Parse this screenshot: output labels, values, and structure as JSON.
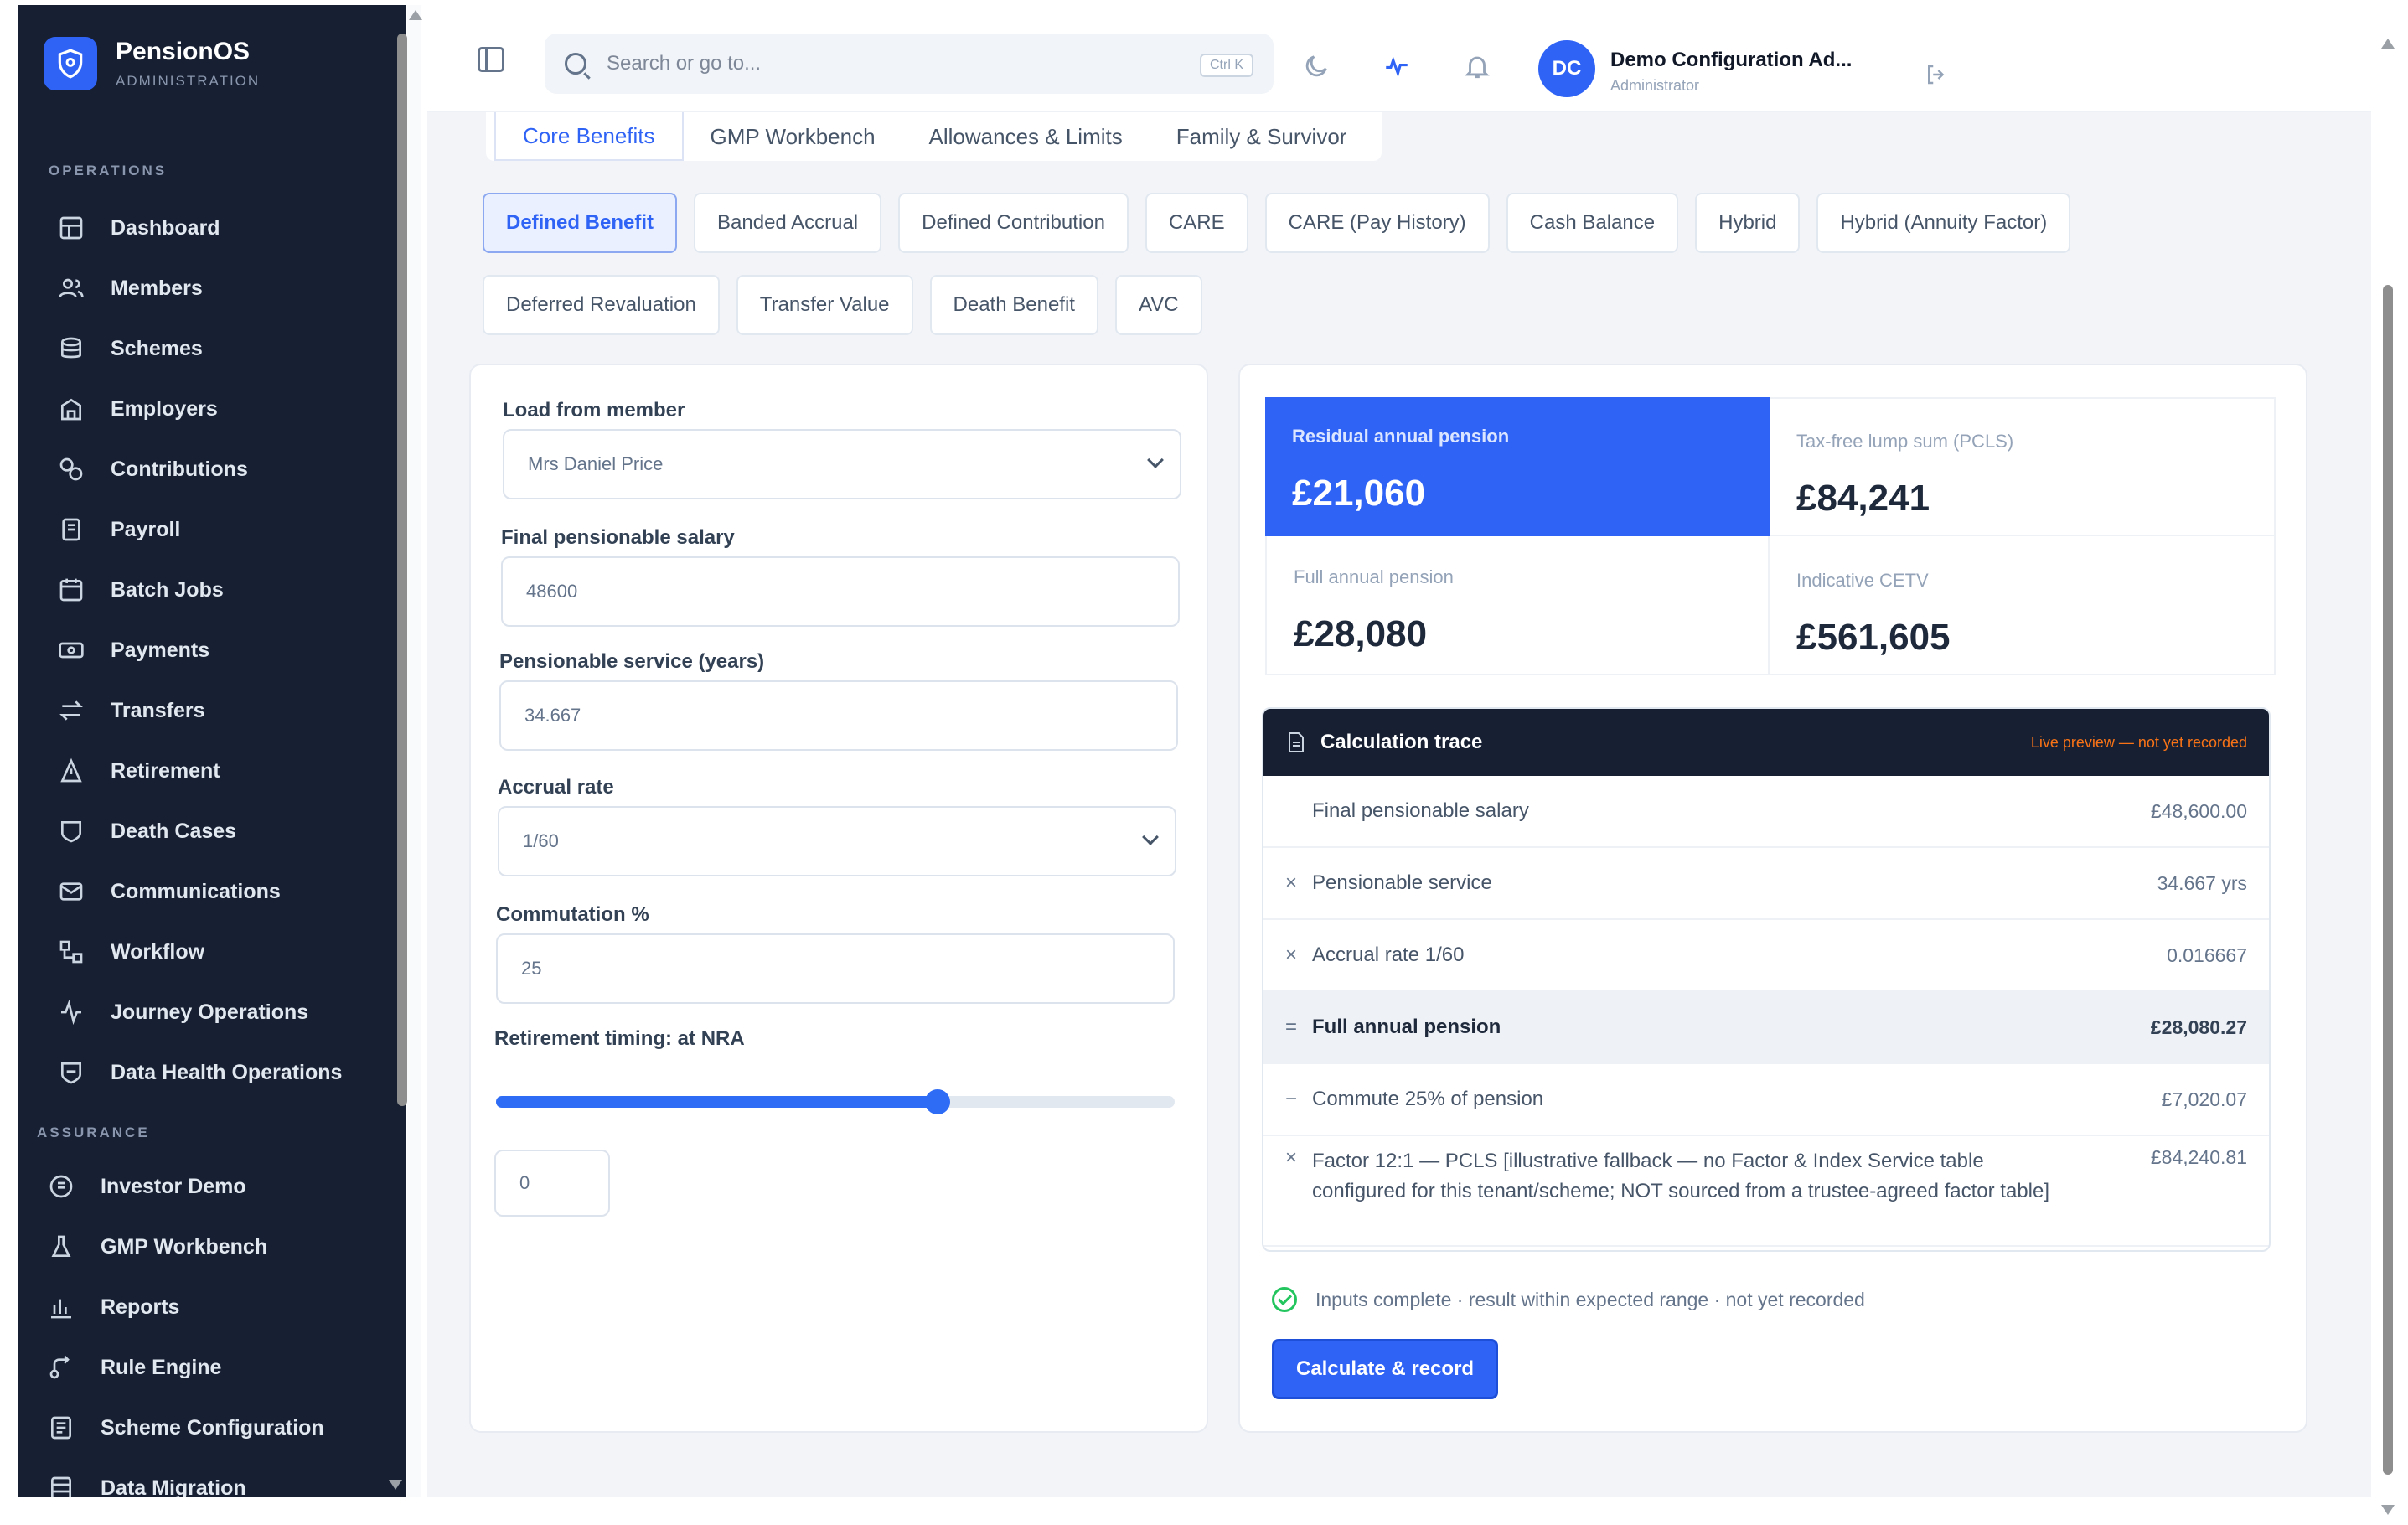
{
  "brand": {
    "name": "PensionOS",
    "sub": "ADMINISTRATION"
  },
  "sidebar": {
    "sections": {
      "operations": "OPERATIONS",
      "assurance": "ASSURANCE"
    },
    "operations": [
      {
        "label": "Dashboard",
        "icon": "dashboard-icon"
      },
      {
        "label": "Members",
        "icon": "members-icon"
      },
      {
        "label": "Schemes",
        "icon": "schemes-icon"
      },
      {
        "label": "Employers",
        "icon": "employers-icon"
      },
      {
        "label": "Contributions",
        "icon": "contributions-icon"
      },
      {
        "label": "Payroll",
        "icon": "payroll-icon"
      },
      {
        "label": "Batch Jobs",
        "icon": "batch-jobs-icon"
      },
      {
        "label": "Payments",
        "icon": "payments-icon"
      },
      {
        "label": "Transfers",
        "icon": "transfers-icon"
      },
      {
        "label": "Retirement",
        "icon": "retirement-icon"
      },
      {
        "label": "Death Cases",
        "icon": "death-cases-icon"
      },
      {
        "label": "Communications",
        "icon": "communications-icon"
      },
      {
        "label": "Workflow",
        "icon": "workflow-icon"
      },
      {
        "label": "Journey Operations",
        "icon": "journey-icon"
      },
      {
        "label": "Data Health Operations",
        "icon": "data-health-icon"
      }
    ],
    "assurance": [
      {
        "label": "Investor Demo",
        "icon": "investor-demo-icon"
      },
      {
        "label": "GMP Workbench",
        "icon": "gmp-workbench-icon"
      },
      {
        "label": "Reports",
        "icon": "reports-icon"
      },
      {
        "label": "Rule Engine",
        "icon": "rule-engine-icon"
      },
      {
        "label": "Scheme Configuration",
        "icon": "scheme-config-icon"
      },
      {
        "label": "Data Migration",
        "icon": "data-migration-icon"
      }
    ]
  },
  "topbar": {
    "search_placeholder": "Search or go to...",
    "shortcut": "Ctrl K",
    "user_initials": "DC",
    "user_name": "Demo Configuration Ad...",
    "user_role": "Administrator"
  },
  "main_tabs": [
    "Core Benefits",
    "GMP Workbench",
    "Allowances & Limits",
    "Family & Survivor"
  ],
  "chips_row1": [
    "Defined Benefit",
    "Banded Accrual",
    "Defined Contribution",
    "CARE",
    "CARE (Pay History)",
    "Cash Balance",
    "Hybrid",
    "Hybrid (Annuity Factor)"
  ],
  "chips_row2": [
    "Deferred Revaluation",
    "Transfer Value",
    "Death Benefit",
    "AVC"
  ],
  "form": {
    "member_label": "Load from member",
    "member_value": "Mrs Daniel Price",
    "salary_label": "Final pensionable salary",
    "salary_value": "48600",
    "service_label": "Pensionable service (years)",
    "service_value": "34.667",
    "accrual_label": "Accrual rate",
    "accrual_value": "1/60",
    "commutation_label": "Commutation %",
    "commutation_value": "25",
    "timing_label": "Retirement timing: at NRA",
    "timing_input": "0",
    "timing_slider_fraction": 0.65
  },
  "metrics": {
    "residual_label": "Residual annual pension",
    "residual_value": "£21,060",
    "pcls_label": "Tax-free lump sum (PCLS)",
    "pcls_value": "£84,241",
    "full_label": "Full annual pension",
    "full_value": "£28,080",
    "cetv_label": "Indicative CETV",
    "cetv_value": "£561,605"
  },
  "trace": {
    "title": "Calculation trace",
    "note": "Live preview — not yet recorded",
    "rows": [
      {
        "op": "",
        "text": "Final pensionable salary",
        "value": "£48,600.00"
      },
      {
        "op": "×",
        "text": "Pensionable service",
        "value": "34.667 yrs"
      },
      {
        "op": "×",
        "text": "Accrual rate 1/60",
        "value": "0.016667"
      },
      {
        "op": "=",
        "text": "Full annual pension",
        "value": "£28,080.27"
      },
      {
        "op": "−",
        "text": "Commute 25% of pension",
        "value": "£7,020.07"
      },
      {
        "op": "×",
        "text": "Factor 12:1 — PCLS [illustrative fallback — no Factor & Index Service table configured for this tenant/scheme; NOT sourced from a trustee-agreed factor table]",
        "value": "£84,240.81"
      }
    ]
  },
  "status_text": "Inputs complete · result within expected range · not yet recorded",
  "calc_button": "Calculate & record",
  "colors": {
    "accent": "#2f63f5",
    "sidebar": "#172033",
    "warning": "#f97316",
    "success": "#22c55e"
  }
}
